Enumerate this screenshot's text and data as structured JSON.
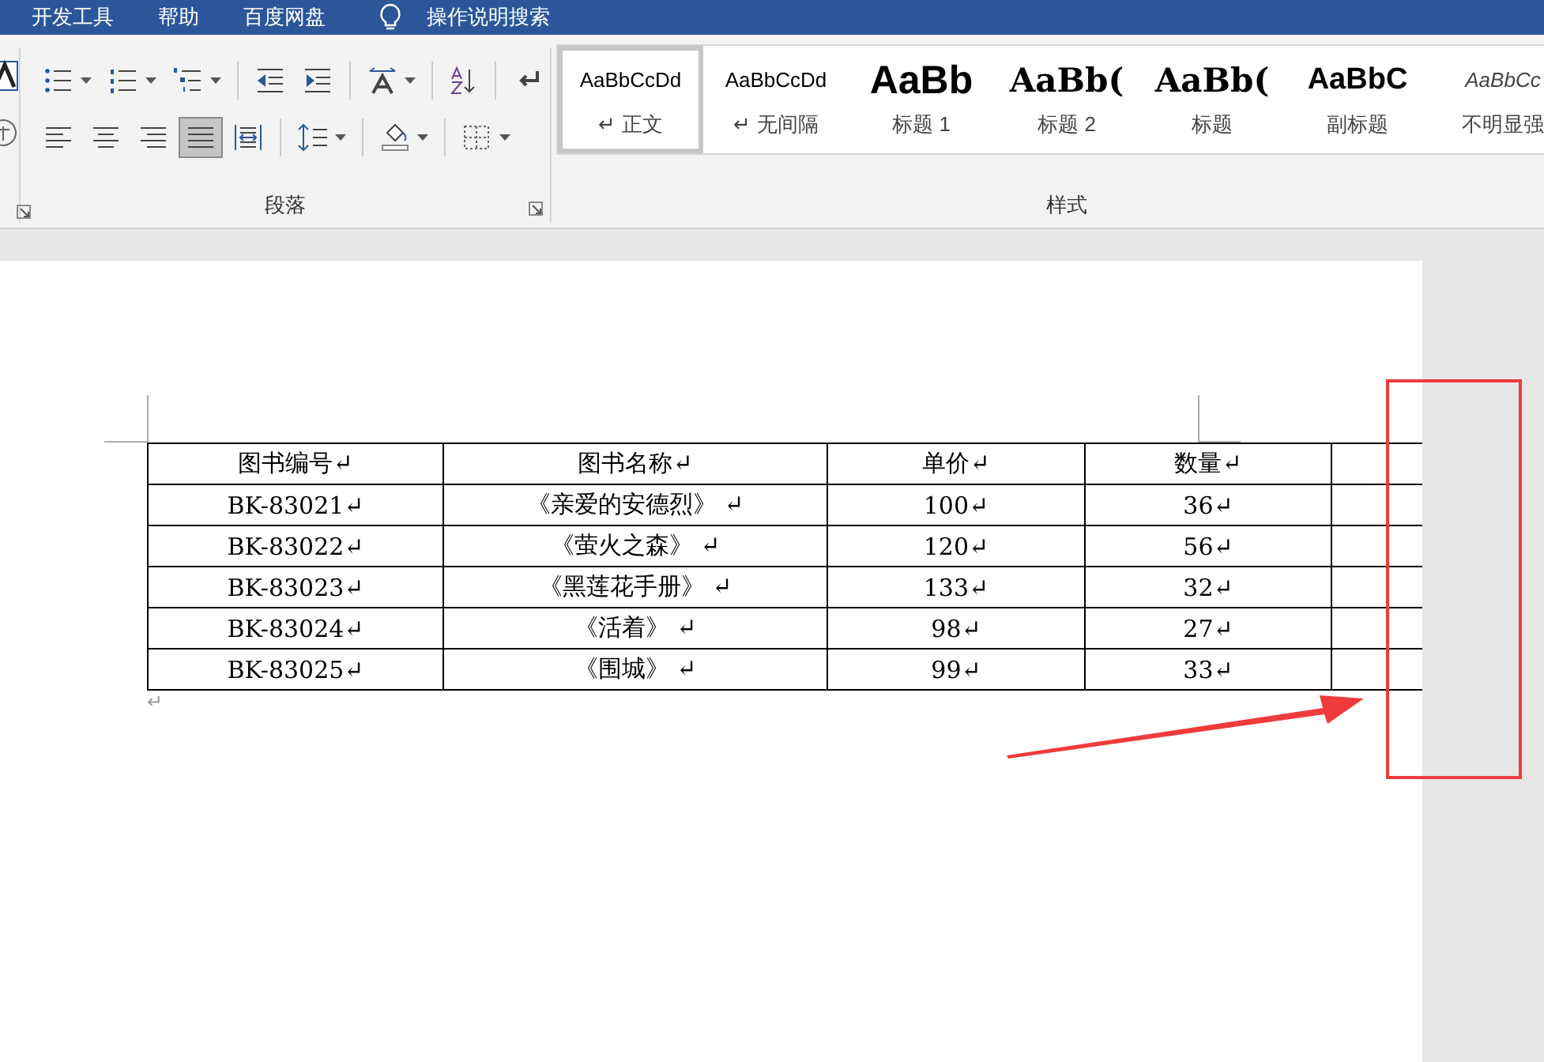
{
  "tabs": [
    {
      "label": "开发工具"
    },
    {
      "label": "帮助"
    },
    {
      "label": "百度网盘"
    }
  ],
  "search": {
    "label": "操作说明搜索"
  },
  "paragraph_group": {
    "label": "段落",
    "row_1": [
      {
        "kind": "bullets"
      },
      {
        "kind": "numbering"
      },
      {
        "kind": "multilevel"
      },
      {
        "kind": "outdent"
      },
      {
        "kind": "indent"
      },
      {
        "kind": "text-direction"
      },
      {
        "kind": "sort"
      },
      {
        "kind": "marks"
      }
    ],
    "alignment": [
      {
        "kind": "left",
        "selected": false
      },
      {
        "kind": "center",
        "selected": false
      },
      {
        "kind": "right",
        "selected": false
      },
      {
        "kind": "justify",
        "selected": true
      },
      {
        "kind": "distributed",
        "selected": false
      }
    ],
    "row_2": [
      {
        "kind": "line-spacing"
      },
      {
        "kind": "shading"
      },
      {
        "kind": "borders"
      }
    ]
  },
  "styles_group": {
    "label": "样式",
    "items": [
      {
        "kind": "normal",
        "sample": "AaBbCcDd",
        "label": "↵ 正文",
        "selected": true
      },
      {
        "kind": "no-spacing",
        "sample": "AaBbCcDd",
        "label": "↵ 无间隔",
        "selected": false
      },
      {
        "kind": "heading1",
        "sample": "AaBb",
        "label": "标题 1",
        "selected": false
      },
      {
        "kind": "heading2",
        "sample": "AaBb(",
        "label": "标题 2",
        "selected": false
      },
      {
        "kind": "title",
        "sample": "AaBb(",
        "label": "标题",
        "selected": false
      },
      {
        "kind": "subtitle",
        "sample": "AaBbC",
        "label": "副标题",
        "selected": false
      },
      {
        "kind": "subtle",
        "sample": "AaBbCc",
        "label": "不明显强",
        "selected": false
      }
    ]
  },
  "table": {
    "columns": [
      "图书编号↵",
      "图书名称↵",
      "单价↵",
      "数量↵",
      ""
    ],
    "rows": [
      [
        "BK-83021↵",
        "《亲爱的安德烈》 ↵",
        "100↵",
        "36↵"
      ],
      [
        "BK-83022↵",
        "《萤火之森》 ↵",
        "120↵",
        "56↵"
      ],
      [
        "BK-83023↵",
        "《黑莲花手册》 ↵",
        "133↵",
        "32↵"
      ],
      [
        "BK-83024↵",
        "《活着》 ↵",
        "98↵",
        "27↵"
      ],
      [
        "BK-83025↵",
        "《围城》 ↵",
        "99↵",
        "33↵"
      ]
    ]
  },
  "paragraph_mark": "↵"
}
